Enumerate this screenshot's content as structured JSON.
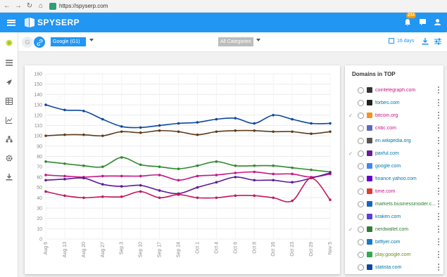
{
  "browser": {
    "url": "https://spyserp.com"
  },
  "app": {
    "brand": "SPYSERP",
    "notification_count": "234"
  },
  "toolbar": {
    "engine_toggle_g": "G",
    "engine_select": "Google (G1)",
    "category_select": "All Categories",
    "period": "16 days"
  },
  "chart_data": {
    "type": "line",
    "x": [
      "Aug 6",
      "Aug 13",
      "Aug 20",
      "Aug 27",
      "Sep 3",
      "Sep 10",
      "Sep 17",
      "Sep 24",
      "Oct 1",
      "Oct 4",
      "Oct 6",
      "Oct 8",
      "Oct 16",
      "Oct 23",
      "Oct 29",
      "Nov 5"
    ],
    "ylim": [
      0,
      160
    ],
    "yticks": [
      0,
      10,
      20,
      30,
      40,
      50,
      60,
      70,
      80,
      90,
      100,
      110,
      120,
      130,
      140,
      150,
      160
    ],
    "series": [
      {
        "color": "#0d47a1",
        "values": [
          130,
          125,
          124,
          116,
          109,
          108,
          110,
          112,
          113,
          116,
          117,
          112,
          120,
          116,
          112,
          112
        ]
      },
      {
        "color": "#5d3a1a",
        "values": [
          100,
          101,
          101,
          100,
          104,
          103,
          105,
          104,
          101,
          104,
          105,
          105,
          104,
          104,
          102,
          104
        ]
      },
      {
        "color": "#2e8b2e",
        "values": [
          75,
          73,
          71,
          70,
          79,
          72,
          70,
          68,
          71,
          75,
          71,
          71,
          71,
          69,
          67,
          65
        ]
      },
      {
        "color": "#c71585",
        "values": [
          62,
          61,
          60,
          61,
          61,
          61,
          62,
          57,
          61,
          62,
          64,
          65,
          63,
          63,
          60,
          63
        ]
      },
      {
        "color": "#5a189a",
        "values": [
          57,
          58,
          59,
          53,
          51,
          52,
          47,
          44,
          50,
          55,
          60,
          57,
          57,
          55,
          59,
          64
        ]
      },
      {
        "color": "#c2185b",
        "values": [
          46,
          42,
          40,
          41,
          41,
          46,
          40,
          43,
          40,
          40,
          42,
          42,
          40,
          37,
          59,
          38
        ]
      }
    ]
  },
  "domains": {
    "title": "Domains in TOP",
    "items": [
      {
        "name": "cointelegraph.com",
        "color": "#c71585",
        "checked": false,
        "fav": "#333"
      },
      {
        "name": "forbes.com",
        "color": "#0077aa",
        "checked": false,
        "fav": "#222"
      },
      {
        "name": "bitcoin.org",
        "color": "#c71585",
        "checked": true,
        "fav": "#f7931a"
      },
      {
        "name": "cnbc.com",
        "color": "#c71585",
        "checked": false,
        "fav": "#5c6bc0"
      },
      {
        "name": "en.wikipedia.org",
        "color": "#0077aa",
        "checked": false,
        "fav": "#555"
      },
      {
        "name": "paxful.com",
        "color": "#0077aa",
        "checked": true,
        "fav": "#6a1b9a"
      },
      {
        "name": "google.com",
        "color": "#0077aa",
        "checked": false,
        "fav": "#4285f4"
      },
      {
        "name": "finance.yahoo.com",
        "color": "#0077aa",
        "checked": false,
        "fav": "#6001d2"
      },
      {
        "name": "time.com",
        "color": "#c71585",
        "checked": false,
        "fav": "#e53935"
      },
      {
        "name": "markets.businessinsider.c...",
        "color": "#2e7d32",
        "checked": false,
        "fav": "#1565c0"
      },
      {
        "name": "kraken.com",
        "color": "#0077aa",
        "checked": false,
        "fav": "#5741d9"
      },
      {
        "name": "nerdwallet.com",
        "color": "#2e7d32",
        "checked": true,
        "fav": "#2e7d32"
      },
      {
        "name": "bitflyer.com",
        "color": "#0077aa",
        "checked": false,
        "fav": "#1976d2"
      },
      {
        "name": "play.google.com",
        "color": "#6b8e23",
        "checked": false,
        "fav": "#34a853"
      },
      {
        "name": "statista.com",
        "color": "#0077aa",
        "checked": false,
        "fav": "#0d47a1"
      }
    ]
  }
}
